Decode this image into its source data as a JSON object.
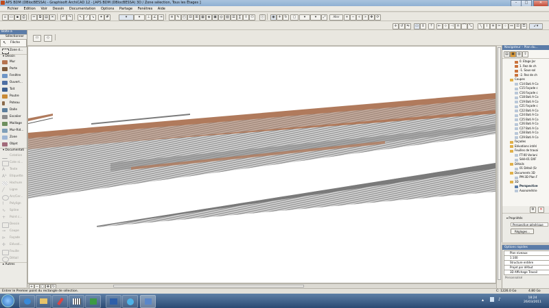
{
  "window": {
    "title": "APS BDM (DBlocBESSA) - Graphisoft ArchiCAD 12 - [APS BDM (DBlocBESSA) 3D / Zone sélection, Tous les Étages ]",
    "minimize": "–",
    "maximize": "□",
    "close": "✕"
  },
  "menu": [
    "Fichier",
    "Edition",
    "Voir",
    "Dessin",
    "Documentation",
    "Options",
    "Partage",
    "Fenêtres",
    "Aide"
  ],
  "toolbar": {
    "zoom_value": "Aller"
  },
  "toolbox": {
    "header": "Boîte à",
    "select_section": "Sélectionner",
    "select_tools": [
      "Flèche",
      "Zone d..."
    ],
    "draw_section": "Dessin",
    "draw_tools": [
      "Mur",
      "Porte",
      "Fenêtre",
      "Ouvert...",
      "Toit",
      "Poutre",
      "Poteau",
      "Dalle",
      "Escalier",
      "Maillage",
      "Mur-Rid...",
      "Zone",
      "Objet"
    ],
    "doc_section": "Documentati",
    "doc_tools": [
      "Cotation",
      "Cote ni...",
      "Texte",
      "Etiquette",
      "Hachure",
      "Ligne",
      "Arc/Cer...",
      "Polylign",
      "Spline",
      "Point c...",
      "Dessin",
      "Coupe",
      "Façade",
      "Elévati...",
      "Feuille",
      "Détail"
    ],
    "more": "Autres"
  },
  "navigator": {
    "header": "Navigateur – Plan du...",
    "items": [
      {
        "label": "0. Etage Jar",
        "indent": 2,
        "kind": "level"
      },
      {
        "label": "1. Rez de ch",
        "indent": 2,
        "kind": "level"
      },
      {
        "label": "-1. Sous-sol",
        "indent": 2,
        "kind": "level"
      },
      {
        "label": "-2. Rez de ch",
        "indent": 2,
        "kind": "level"
      },
      {
        "label": "Coupes",
        "indent": 1,
        "kind": "folder"
      },
      {
        "label": "C14 Bati A Co",
        "indent": 2,
        "kind": "doc"
      },
      {
        "label": "C15 Façade c",
        "indent": 2,
        "kind": "doc"
      },
      {
        "label": "C16 Façade c",
        "indent": 2,
        "kind": "doc"
      },
      {
        "label": "C18 Bati A Co",
        "indent": 2,
        "kind": "doc"
      },
      {
        "label": "C19 Bati A Co",
        "indent": 2,
        "kind": "doc"
      },
      {
        "label": "C21 Façade c",
        "indent": 2,
        "kind": "doc"
      },
      {
        "label": "C22 Bati A Co",
        "indent": 2,
        "kind": "doc"
      },
      {
        "label": "C24 Bati A Co",
        "indent": 2,
        "kind": "doc"
      },
      {
        "label": "C25 Bati A Co",
        "indent": 2,
        "kind": "doc"
      },
      {
        "label": "C26 Bati A Co",
        "indent": 2,
        "kind": "doc"
      },
      {
        "label": "C27 Bati A Co",
        "indent": 2,
        "kind": "doc"
      },
      {
        "label": "C28 Bati A Co",
        "indent": 2,
        "kind": "doc"
      },
      {
        "label": "C29 Bati A Co",
        "indent": 2,
        "kind": "doc"
      },
      {
        "label": "Façades",
        "indent": 1,
        "kind": "folder"
      },
      {
        "label": "Elévations intéri",
        "indent": 1,
        "kind": "folder"
      },
      {
        "label": "Feuilles de travai",
        "indent": 1,
        "kind": "folder"
      },
      {
        "label": "FT-00 Variani",
        "indent": 2,
        "kind": "doc"
      },
      {
        "label": "Sélé-01 DXF",
        "indent": 2,
        "kind": "doc"
      },
      {
        "label": "Détails",
        "indent": 1,
        "kind": "folder"
      },
      {
        "label": "01 Détail (Sr",
        "indent": 2,
        "kind": "doc"
      },
      {
        "label": "Documents 3D",
        "indent": 1,
        "kind": "folder"
      },
      {
        "label": "PM-3D Plan F",
        "indent": 2,
        "kind": "doc"
      },
      {
        "label": "3D",
        "indent": 1,
        "kind": "folder"
      },
      {
        "label": "Perspective",
        "indent": 2,
        "kind": "active"
      },
      {
        "label": "Axonométrie",
        "indent": 2,
        "kind": "doc"
      }
    ]
  },
  "properties": {
    "title": "Propriétés",
    "value": "Perspective générique",
    "button": "Réglages..."
  },
  "quick_options": {
    "header": "Options rapides",
    "rows": [
      "Plan niveaux",
      "1:100",
      "Structure entière",
      "Projet par défaut",
      "3D Affichage Travail"
    ],
    "footer": "Personnalisé"
  },
  "status": {
    "prompt": "Entrer le Premier point du rectangle de sélection.",
    "disk": "C: 1226.0 Go",
    "ram": "4.80 Go"
  },
  "taskbar": {
    "time": "18:24",
    "date": "26/03/2011"
  },
  "colors": {
    "accent": "#5b7ca8",
    "wall_brown": "#b07a5c",
    "mesh_grey": "#8c8c8c"
  }
}
